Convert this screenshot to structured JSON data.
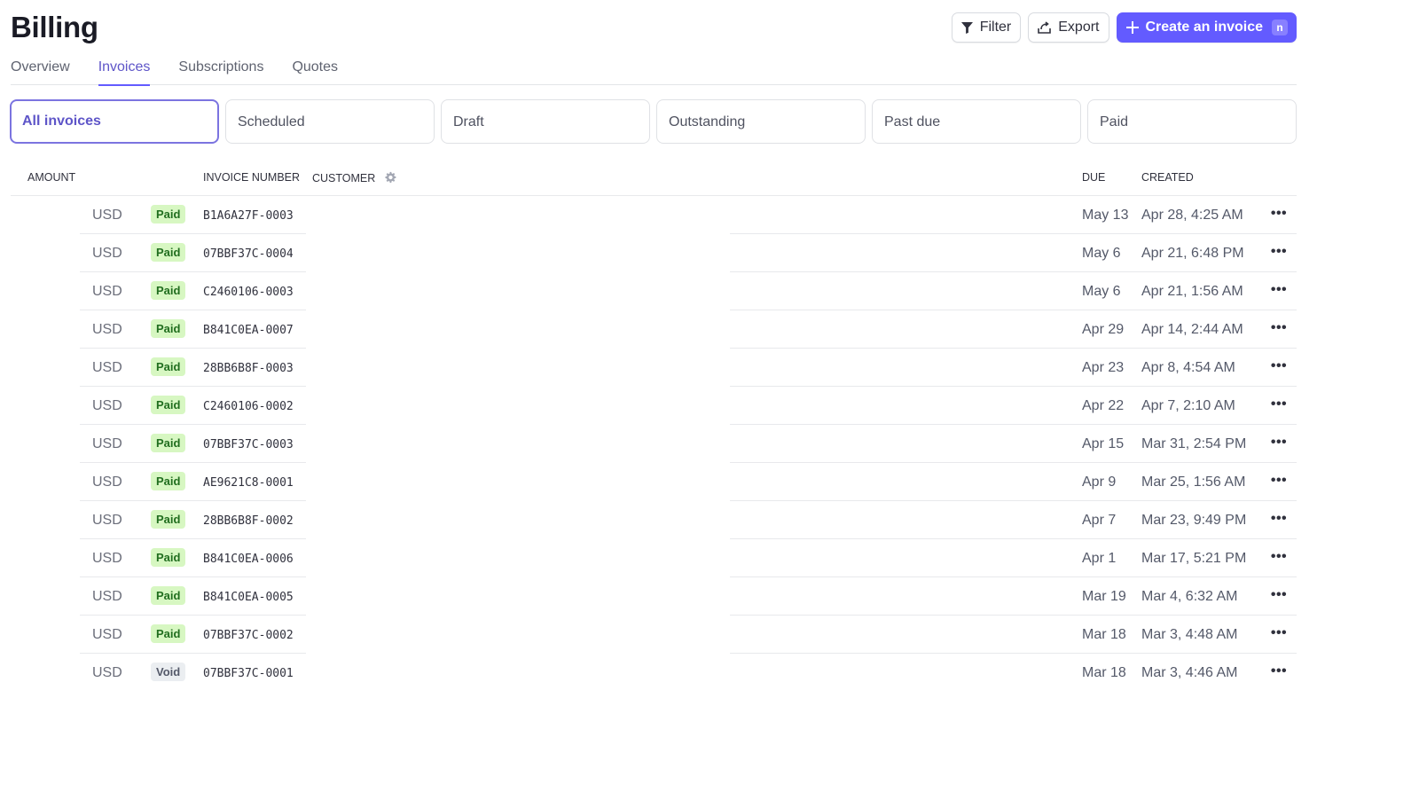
{
  "header": {
    "title": "Billing",
    "filter_label": "Filter",
    "export_label": "Export",
    "create_label": "Create an invoice",
    "create_shortcut": "n",
    "accent_color": "#635bff"
  },
  "tabs": [
    {
      "label": "Overview",
      "active": false
    },
    {
      "label": "Invoices",
      "active": true
    },
    {
      "label": "Subscriptions",
      "active": false
    },
    {
      "label": "Quotes",
      "active": false
    }
  ],
  "filters": [
    {
      "label": "All invoices",
      "active": true
    },
    {
      "label": "Scheduled",
      "active": false
    },
    {
      "label": "Draft",
      "active": false
    },
    {
      "label": "Outstanding",
      "active": false
    },
    {
      "label": "Past due",
      "active": false
    },
    {
      "label": "Paid",
      "active": false
    }
  ],
  "columns": {
    "amount": "AMOUNT",
    "invoice_number": "INVOICE NUMBER",
    "customer": "CUSTOMER",
    "due": "DUE",
    "created": "CREATED"
  },
  "rows": [
    {
      "currency": "USD",
      "status": "Paid",
      "invoice": "B1A6A27F-0003",
      "due": "May 13",
      "created": "Apr 28, 4:25 AM"
    },
    {
      "currency": "USD",
      "status": "Paid",
      "invoice": "07BBF37C-0004",
      "due": "May 6",
      "created": "Apr 21, 6:48 PM"
    },
    {
      "currency": "USD",
      "status": "Paid",
      "invoice": "C2460106-0003",
      "due": "May 6",
      "created": "Apr 21, 1:56 AM"
    },
    {
      "currency": "USD",
      "status": "Paid",
      "invoice": "B841C0EA-0007",
      "due": "Apr 29",
      "created": "Apr 14, 2:44 AM"
    },
    {
      "currency": "USD",
      "status": "Paid",
      "invoice": "28BB6B8F-0003",
      "due": "Apr 23",
      "created": "Apr 8, 4:54 AM"
    },
    {
      "currency": "USD",
      "status": "Paid",
      "invoice": "C2460106-0002",
      "due": "Apr 22",
      "created": "Apr 7, 2:10 AM"
    },
    {
      "currency": "USD",
      "status": "Paid",
      "invoice": "07BBF37C-0003",
      "due": "Apr 15",
      "created": "Mar 31, 2:54 PM"
    },
    {
      "currency": "USD",
      "status": "Paid",
      "invoice": "AE9621C8-0001",
      "due": "Apr 9",
      "created": "Mar 25, 1:56 AM"
    },
    {
      "currency": "USD",
      "status": "Paid",
      "invoice": "28BB6B8F-0002",
      "due": "Apr 7",
      "created": "Mar 23, 9:49 PM"
    },
    {
      "currency": "USD",
      "status": "Paid",
      "invoice": "B841C0EA-0006",
      "due": "Apr 1",
      "created": "Mar 17, 5:21 PM"
    },
    {
      "currency": "USD",
      "status": "Paid",
      "invoice": "B841C0EA-0005",
      "due": "Mar 19",
      "created": "Mar 4, 6:32 AM"
    },
    {
      "currency": "USD",
      "status": "Paid",
      "invoice": "07BBF37C-0002",
      "due": "Mar 18",
      "created": "Mar 3, 4:48 AM"
    },
    {
      "currency": "USD",
      "status": "Void",
      "invoice": "07BBF37C-0001",
      "due": "Mar 18",
      "created": "Mar 3, 4:46 AM"
    }
  ],
  "row_menu_glyph": "•••"
}
